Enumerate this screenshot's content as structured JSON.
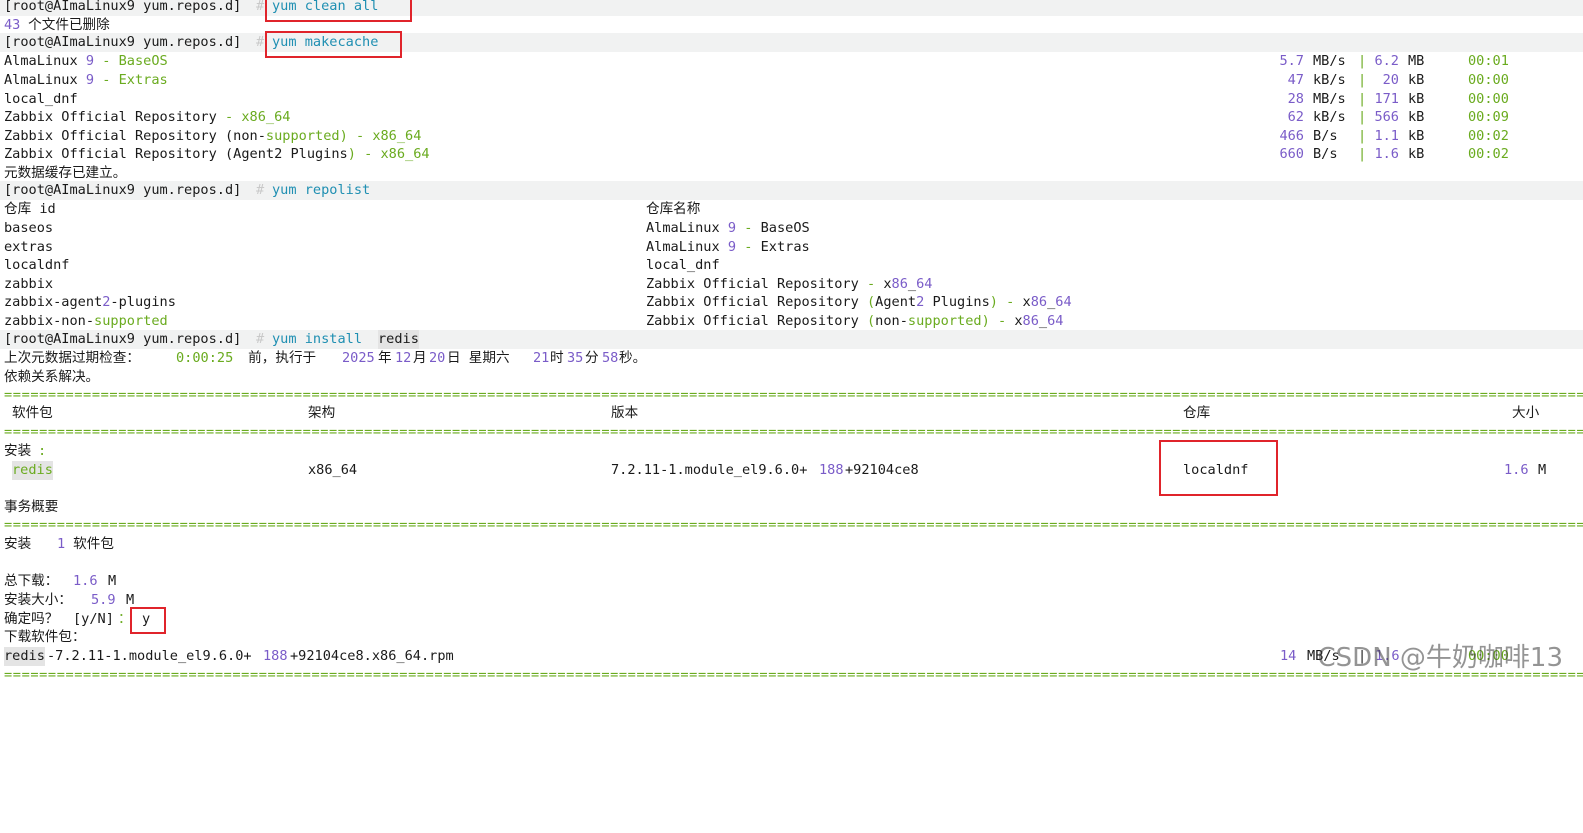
{
  "prompt": {
    "base": "[root@AImaLinux9 yum.repos.d]",
    "mark": "#"
  },
  "clean": {
    "cmd": "yum clean all",
    "result_num": "43",
    "result_text": " 个文件已删除"
  },
  "makecache": {
    "cmd": "yum makecache",
    "repos": [
      {
        "parts": [
          "AlmaLinux ",
          "9",
          " - BaseOS"
        ],
        "speed": "5.7",
        "speed_unit": "MB/s",
        "size": "6.2",
        "size_unit": "MB",
        "time": "00:01"
      },
      {
        "parts": [
          "AlmaLinux ",
          "9",
          " - Extras"
        ],
        "speed": "47",
        "speed_unit": "kB/s",
        "size": "20",
        "size_unit": "kB",
        "time": "00:00"
      },
      {
        "parts": [
          "local_dnf"
        ],
        "speed": "28",
        "speed_unit": "MB/s",
        "size": "171",
        "size_unit": "kB",
        "time": "00:00"
      },
      {
        "parts": [
          "Zabbix Official Repository ",
          "- x86_64"
        ],
        "speed": "62",
        "speed_unit": "kB/s",
        "size": "566",
        "size_unit": "kB",
        "time": "00:09"
      },
      {
        "parts": [
          "Zabbix Official Repository (non-",
          "supported",
          ") - x86_64"
        ],
        "speed": "466",
        "speed_unit": "B/s",
        "size": "1.1",
        "size_unit": "kB",
        "time": "00:02"
      },
      {
        "parts": [
          "Zabbix Official Repository (Agent2 Plugins",
          ") - x86_64"
        ],
        "speed": "660",
        "speed_unit": "B/s",
        "size": "1.6",
        "size_unit": "kB",
        "time": "00:02"
      }
    ],
    "done": "元数据缓存已建立。"
  },
  "repolist": {
    "cmd": "yum repolist",
    "col_id": "仓库 id",
    "col_name": "仓库名称",
    "rows": [
      {
        "id": "baseos",
        "name": "AlmaLinux 9 - BaseOS"
      },
      {
        "id": "extras",
        "name": "AlmaLinux 9 - Extras"
      },
      {
        "id": "localdnf",
        "name": "local_dnf"
      },
      {
        "id": "zabbix",
        "name": "Zabbix Official Repository - x86_64"
      },
      {
        "id": "zabbix-agent2-plugins",
        "name": "Zabbix Official Repository (Agent2 Plugins) - x86_64"
      },
      {
        "id": "zabbix-non-supported",
        "name": "Zabbix Official Repository (non-supported) - x86_64"
      }
    ]
  },
  "install": {
    "cmd_prefix": "yum install ",
    "cmd_pkg": "redis",
    "meta_check": {
      "prefix": "上次元数据过期检查：",
      "elapsed": "0:00:25",
      "mid": " 前，执行于 ",
      "year": "2025",
      "y": "年",
      "month": "12",
      "mo": "月",
      "day": "20",
      "d": "日 星期六 ",
      "hour": "21",
      "h": "时",
      "min": "35",
      "mi": "分",
      "sec": "58",
      "s": "秒。"
    },
    "resolved": "依赖关系解决。",
    "separator": "================================================================================================================================================================================================================",
    "headers": {
      "pkg": "软件包",
      "arch": "架构",
      "version": "版本",
      "repo": "仓库",
      "size": "大小"
    },
    "section": "安装",
    "colon": ":",
    "package": {
      "name": "redis",
      "arch": "x86_64",
      "version_a": "7.2.11-1.module_el9.6.0+",
      "version_b": "188",
      "version_c": "+92104ce8",
      "repo": "localdnf",
      "size_num": "1.6",
      "size_unit": "M"
    },
    "summary_title": "事务概要",
    "summary_line": {
      "label": "安装  ",
      "count": "1",
      "unit": " 软件包"
    },
    "total_download": {
      "label": "总下载：",
      "num": "1.6",
      "unit": "M"
    },
    "installed_size": {
      "label": "安装大小：",
      "num": "5.9",
      "unit": "M"
    },
    "confirm": {
      "label": "确定吗？",
      "options": "[y/N]",
      "colon": "：",
      "answer": "y"
    },
    "downloading": "下载软件包：",
    "rpm": {
      "name": "redis",
      "a": "-7.2.11-1.module_el9.6.0+",
      "b": "188",
      "c": "+92104ce8.x86_64.rpm",
      "speed": "14",
      "speed_unit": "MB/s",
      "size_sep": "|",
      "size": "1.6",
      "time": "00:00"
    }
  },
  "watermark": "CSDN @牛奶咖啡13",
  "colors": {
    "number": "#7a5cc8",
    "green": "#6aab1f",
    "command": "#1f8fb2",
    "highlight_box": "#e0242b"
  }
}
